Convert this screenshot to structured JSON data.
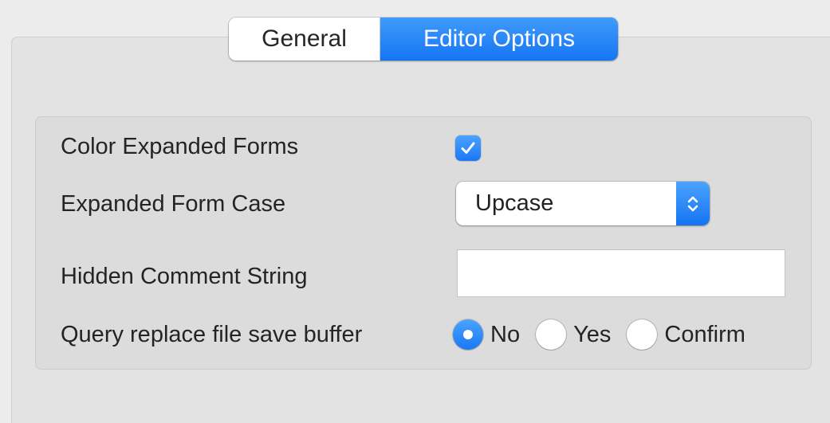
{
  "tabs": [
    {
      "label": "General",
      "selected": false
    },
    {
      "label": "Editor Options",
      "selected": true
    }
  ],
  "options": {
    "color_expanded_forms": {
      "label": "Color Expanded Forms",
      "checked": true
    },
    "expanded_form_case": {
      "label": "Expanded Form Case",
      "value": "Upcase"
    },
    "hidden_comment_string": {
      "label": "Hidden Comment String",
      "value": ""
    },
    "query_replace": {
      "label": "Query replace file save buffer",
      "choices": [
        {
          "label": "No",
          "selected": true
        },
        {
          "label": "Yes",
          "selected": false
        },
        {
          "label": "Confirm",
          "selected": false
        }
      ]
    }
  },
  "colors": {
    "accent": "#1a78f5",
    "background": "#ececec",
    "group_box": "#dcdcdc"
  },
  "icons": {
    "checkbox_mark": "checkmark-icon",
    "popup_arrows": "chevron-up-down-icon"
  }
}
